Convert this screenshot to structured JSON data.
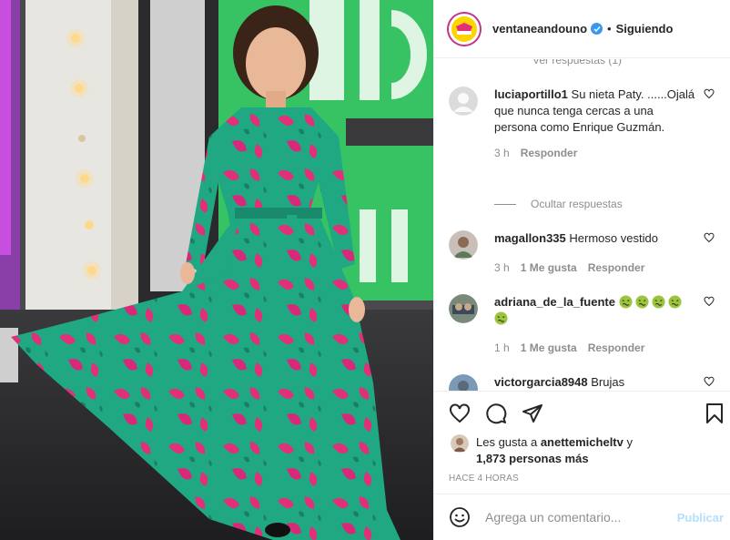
{
  "header": {
    "username": "ventaneandouno",
    "verified": true,
    "separator": "•",
    "follow_status": "Siguiendo",
    "avatar_logo_text": "Ventaneando"
  },
  "comments_section": {
    "cut_off_text": "Ver respuestas (1)",
    "comments": [
      {
        "username": "luciaportillo1",
        "text": "Su nieta Paty. ......Ojalá que nunca tenga cercas a una persona como Enrique Guzmán.",
        "time": "3 h",
        "likes": "",
        "reply_label": "Responder"
      },
      {
        "username": "magallon335",
        "text": "Hermoso vestido",
        "time": "3 h",
        "likes": "1 Me gusta",
        "reply_label": "Responder"
      },
      {
        "username": "adriana_de_la_fuente",
        "text": "",
        "emoji": "nauseated-face-emoji",
        "emoji_count": 5,
        "time": "1 h",
        "likes": "1 Me gusta",
        "reply_label": "Responder"
      },
      {
        "username": "victorgarcia8948",
        "text": "Brujas"
      }
    ],
    "hide_replies_label": "Ocultar respuestas"
  },
  "actions": {
    "icons": [
      "heart-icon",
      "comment-icon",
      "share-icon",
      "bookmark-icon"
    ],
    "likes_prefix": "Les gusta a ",
    "likes_user": "anettemicheltv",
    "likes_suffix": " y",
    "likes_others": "1,873 personas más",
    "timestamp": "HACE 4 HORAS"
  },
  "add_comment": {
    "placeholder": "Agrega un comentario...",
    "post_label": "Publicar"
  },
  "colors": {
    "accent_blue": "#3897f0",
    "post_disabled": "#b2dffc",
    "muted": "#8e8e8e",
    "dress_green": "#1fa882",
    "dress_pink": "#e0307a"
  }
}
